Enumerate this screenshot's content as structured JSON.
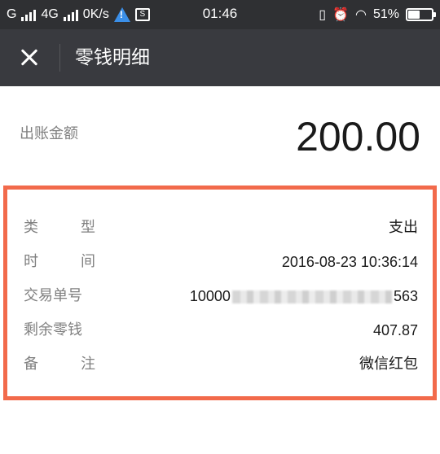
{
  "status_bar": {
    "carrier_left": "G",
    "network_type": "4G",
    "speed": "0K/s",
    "time": "01:46",
    "battery": "51%",
    "battery_level": 0.51
  },
  "header": {
    "title": "零钱明细"
  },
  "amount": {
    "label": "出账金额",
    "value": "200.00"
  },
  "details": {
    "type_label_1": "类",
    "type_label_2": "型",
    "type_value": "支出",
    "time_label_1": "时",
    "time_label_2": "间",
    "time_value": "2016-08-23 10:36:14",
    "txid_label": "交易单号",
    "txid_prefix": "10000",
    "txid_suffix": "563",
    "balance_label": "剩余零钱",
    "balance_value": "407.87",
    "note_label_1": "备",
    "note_label_2": "注",
    "note_value": "微信红包"
  }
}
